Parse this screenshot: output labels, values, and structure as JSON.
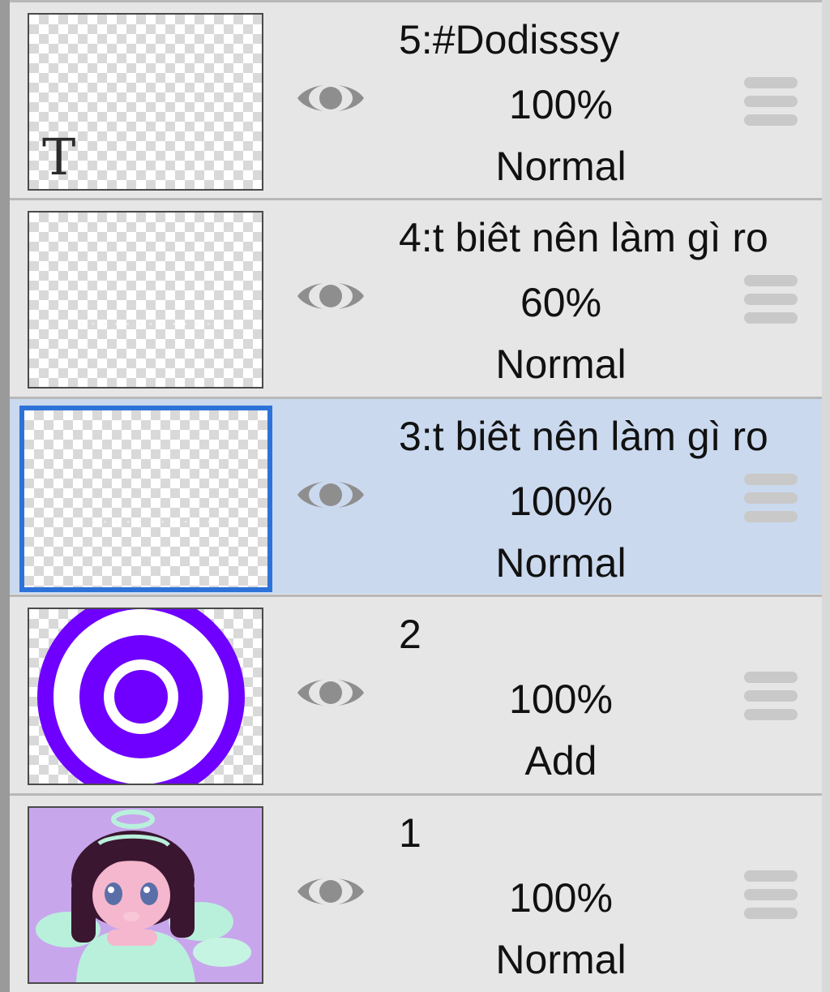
{
  "panel": "Layers",
  "layers": [
    {
      "name": "5:#Dodisssy",
      "opacity": "100%",
      "blend": "Normal",
      "visible": true,
      "selected": false,
      "thumbnail": "text-layer-icon",
      "thumb_glyph": "T"
    },
    {
      "name": "4:t biêt nên làm gì ro",
      "opacity": "60%",
      "blend": "Normal",
      "visible": true,
      "selected": false,
      "thumbnail": "transparent-layer"
    },
    {
      "name": "3:t biêt nên làm gì ro",
      "opacity": "100%",
      "blend": "Normal",
      "visible": true,
      "selected": true,
      "thumbnail": "transparent-layer"
    },
    {
      "name": "2",
      "opacity": "100%",
      "blend": "Add",
      "visible": true,
      "selected": false,
      "thumbnail": "purple-concentric-rings"
    },
    {
      "name": "1",
      "opacity": "100%",
      "blend": "Normal",
      "visible": true,
      "selected": false,
      "thumbnail": "angel-girl-illustration"
    }
  ],
  "colors": {
    "selected_background": "#cad9ee",
    "selection_border": "#2d72d9",
    "ring_purple": "#6f00ff",
    "illustration_background": "#c8a6ec",
    "wing_mint": "#b9f0dc"
  }
}
